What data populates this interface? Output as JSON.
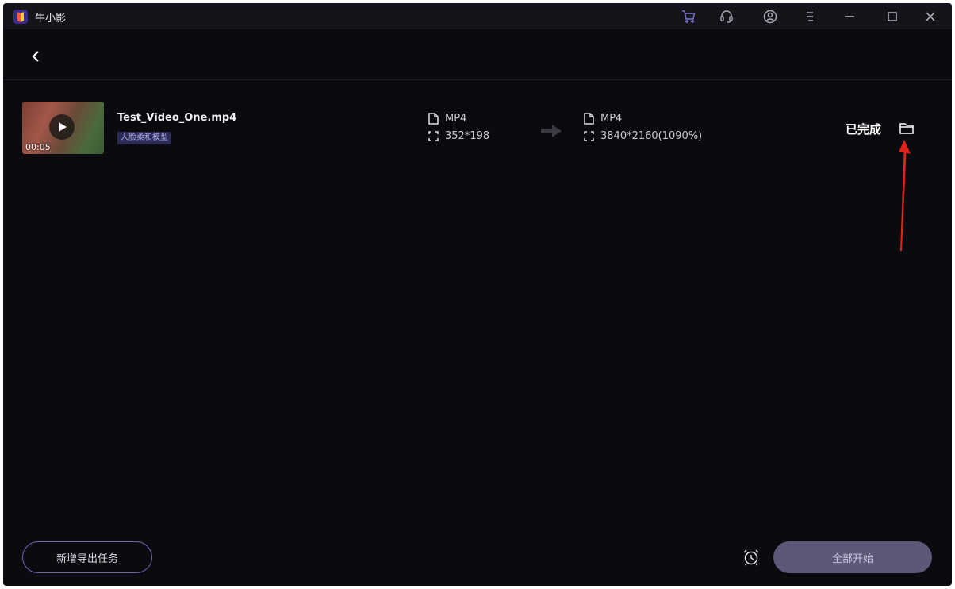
{
  "app": {
    "title": "牛小影"
  },
  "titlebar": {
    "icons": [
      "cart-icon",
      "headset-icon",
      "user-icon",
      "menu-icon",
      "minimize-icon",
      "maximize-icon",
      "close-icon"
    ]
  },
  "task": {
    "file_name": "Test_Video_One.mp4",
    "model_tag": "人脸柔和模型",
    "duration": "00:05",
    "source": {
      "format": "MP4",
      "resolution": "352*198"
    },
    "output": {
      "format": "MP4",
      "resolution": "3840*2160(1090%)"
    },
    "status": "已完成"
  },
  "footer": {
    "add_task_label": "新增导出任务",
    "start_all_label": "全部开始"
  },
  "colors": {
    "background": "#0b0b0f",
    "titlebar": "#14141a",
    "accent_outline": "#6c68b8",
    "start_button": "#5b5878",
    "annotation_arrow": "#e0241b"
  }
}
